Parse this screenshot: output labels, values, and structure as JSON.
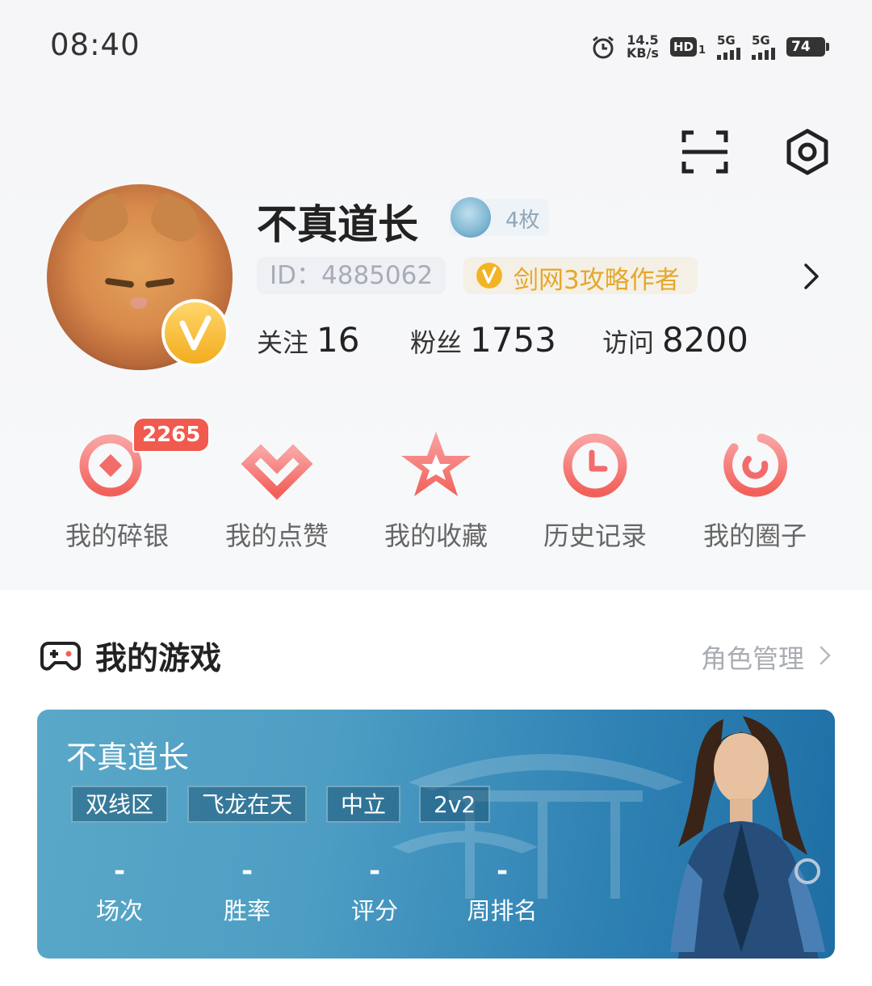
{
  "status_bar": {
    "time": "08:40",
    "net_speed_value": "14.5",
    "net_speed_unit": "KB/s",
    "hd_label": "HD",
    "hd_sub": "1",
    "sim1_label": "5G",
    "sim2_label": "5G",
    "battery": "74"
  },
  "header": {
    "scan_icon": "scan-icon",
    "settings_icon": "settings-icon"
  },
  "profile": {
    "username": "不真道长",
    "medal_count": "4枚",
    "id_text": "ID：4885062",
    "author_badge": "剑网3攻略作者",
    "stats": [
      {
        "label": "关注",
        "value": "16"
      },
      {
        "label": "粉丝",
        "value": "1753"
      },
      {
        "label": "访问",
        "value": "8200"
      }
    ]
  },
  "quick_actions": [
    {
      "label": "我的碎银",
      "icon": "coin-icon",
      "badge": "2265"
    },
    {
      "label": "我的点赞",
      "icon": "heart-icon"
    },
    {
      "label": "我的收藏",
      "icon": "star-icon"
    },
    {
      "label": "历史记录",
      "icon": "clock-icon"
    },
    {
      "label": "我的圈子",
      "icon": "circle-icon"
    }
  ],
  "my_games": {
    "title": "我的游戏",
    "manage_link": "角色管理",
    "card": {
      "character_name": "不真道长",
      "tags": [
        "双线区",
        "飞龙在天",
        "中立",
        "2v2"
      ],
      "stats": [
        {
          "value": "-",
          "label": "场次"
        },
        {
          "value": "-",
          "label": "胜率"
        },
        {
          "value": "-",
          "label": "评分"
        },
        {
          "value": "-",
          "label": "周排名"
        }
      ]
    }
  },
  "colors": {
    "accent_red": "#f26c6c",
    "gold": "#e6a72a",
    "card_blue": "#3b8fbd"
  }
}
